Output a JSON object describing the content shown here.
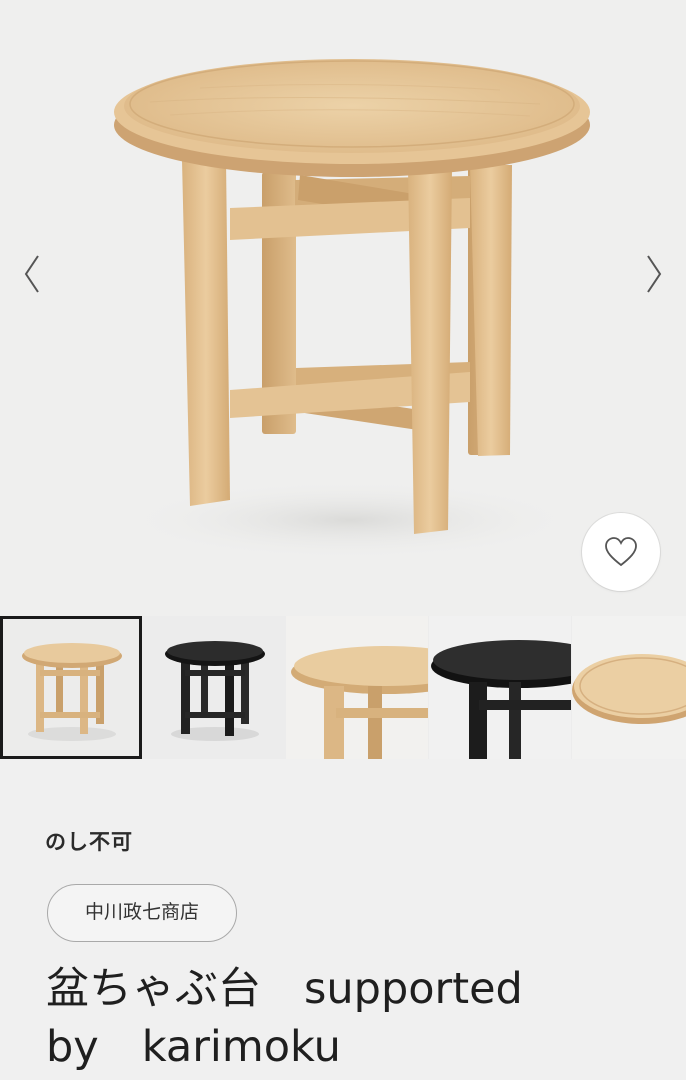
{
  "gallery": {
    "prev_icon": "chevron-left-icon",
    "next_icon": "chevron-right-icon",
    "favorite_icon": "heart-outline-icon",
    "thumbnails": [
      {
        "name": "thumb-natural-table",
        "selected": true
      },
      {
        "name": "thumb-black-table",
        "selected": false
      },
      {
        "name": "thumb-natural-closeup",
        "selected": false
      },
      {
        "name": "thumb-black-closeup",
        "selected": false
      },
      {
        "name": "thumb-tray-top",
        "selected": false
      }
    ]
  },
  "product": {
    "noshi": "のし不可",
    "shop": "中川政七商店",
    "title": "盆ちゃぶ台　supported\nby　karimoku"
  },
  "colors": {
    "wood": "#e2c193",
    "wood_dark": "#c9a372",
    "black_finish": "#1c1c1c",
    "background": "#f0f0f0"
  }
}
